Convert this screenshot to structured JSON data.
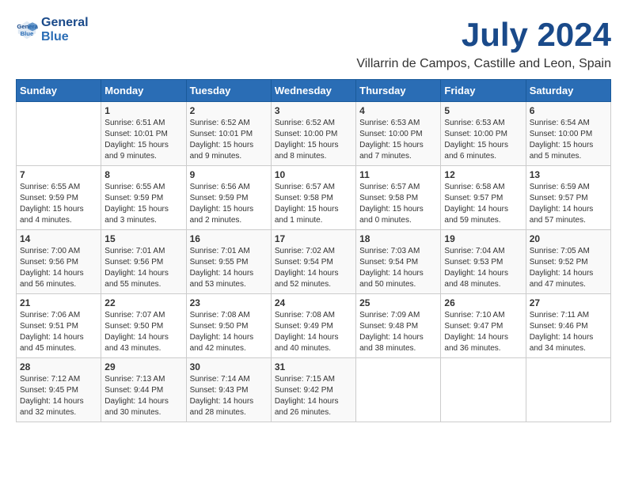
{
  "header": {
    "logo_line1": "General",
    "logo_line2": "Blue",
    "month_title": "July 2024",
    "location": "Villarrin de Campos, Castille and Leon, Spain"
  },
  "days_of_week": [
    "Sunday",
    "Monday",
    "Tuesday",
    "Wednesday",
    "Thursday",
    "Friday",
    "Saturday"
  ],
  "weeks": [
    [
      {
        "num": "",
        "info": ""
      },
      {
        "num": "1",
        "info": "Sunrise: 6:51 AM\nSunset: 10:01 PM\nDaylight: 15 hours\nand 9 minutes."
      },
      {
        "num": "2",
        "info": "Sunrise: 6:52 AM\nSunset: 10:01 PM\nDaylight: 15 hours\nand 9 minutes."
      },
      {
        "num": "3",
        "info": "Sunrise: 6:52 AM\nSunset: 10:00 PM\nDaylight: 15 hours\nand 8 minutes."
      },
      {
        "num": "4",
        "info": "Sunrise: 6:53 AM\nSunset: 10:00 PM\nDaylight: 15 hours\nand 7 minutes."
      },
      {
        "num": "5",
        "info": "Sunrise: 6:53 AM\nSunset: 10:00 PM\nDaylight: 15 hours\nand 6 minutes."
      },
      {
        "num": "6",
        "info": "Sunrise: 6:54 AM\nSunset: 10:00 PM\nDaylight: 15 hours\nand 5 minutes."
      }
    ],
    [
      {
        "num": "7",
        "info": "Sunrise: 6:55 AM\nSunset: 9:59 PM\nDaylight: 15 hours\nand 4 minutes."
      },
      {
        "num": "8",
        "info": "Sunrise: 6:55 AM\nSunset: 9:59 PM\nDaylight: 15 hours\nand 3 minutes."
      },
      {
        "num": "9",
        "info": "Sunrise: 6:56 AM\nSunset: 9:59 PM\nDaylight: 15 hours\nand 2 minutes."
      },
      {
        "num": "10",
        "info": "Sunrise: 6:57 AM\nSunset: 9:58 PM\nDaylight: 15 hours\nand 1 minute."
      },
      {
        "num": "11",
        "info": "Sunrise: 6:57 AM\nSunset: 9:58 PM\nDaylight: 15 hours\nand 0 minutes."
      },
      {
        "num": "12",
        "info": "Sunrise: 6:58 AM\nSunset: 9:57 PM\nDaylight: 14 hours\nand 59 minutes."
      },
      {
        "num": "13",
        "info": "Sunrise: 6:59 AM\nSunset: 9:57 PM\nDaylight: 14 hours\nand 57 minutes."
      }
    ],
    [
      {
        "num": "14",
        "info": "Sunrise: 7:00 AM\nSunset: 9:56 PM\nDaylight: 14 hours\nand 56 minutes."
      },
      {
        "num": "15",
        "info": "Sunrise: 7:01 AM\nSunset: 9:56 PM\nDaylight: 14 hours\nand 55 minutes."
      },
      {
        "num": "16",
        "info": "Sunrise: 7:01 AM\nSunset: 9:55 PM\nDaylight: 14 hours\nand 53 minutes."
      },
      {
        "num": "17",
        "info": "Sunrise: 7:02 AM\nSunset: 9:54 PM\nDaylight: 14 hours\nand 52 minutes."
      },
      {
        "num": "18",
        "info": "Sunrise: 7:03 AM\nSunset: 9:54 PM\nDaylight: 14 hours\nand 50 minutes."
      },
      {
        "num": "19",
        "info": "Sunrise: 7:04 AM\nSunset: 9:53 PM\nDaylight: 14 hours\nand 48 minutes."
      },
      {
        "num": "20",
        "info": "Sunrise: 7:05 AM\nSunset: 9:52 PM\nDaylight: 14 hours\nand 47 minutes."
      }
    ],
    [
      {
        "num": "21",
        "info": "Sunrise: 7:06 AM\nSunset: 9:51 PM\nDaylight: 14 hours\nand 45 minutes."
      },
      {
        "num": "22",
        "info": "Sunrise: 7:07 AM\nSunset: 9:50 PM\nDaylight: 14 hours\nand 43 minutes."
      },
      {
        "num": "23",
        "info": "Sunrise: 7:08 AM\nSunset: 9:50 PM\nDaylight: 14 hours\nand 42 minutes."
      },
      {
        "num": "24",
        "info": "Sunrise: 7:08 AM\nSunset: 9:49 PM\nDaylight: 14 hours\nand 40 minutes."
      },
      {
        "num": "25",
        "info": "Sunrise: 7:09 AM\nSunset: 9:48 PM\nDaylight: 14 hours\nand 38 minutes."
      },
      {
        "num": "26",
        "info": "Sunrise: 7:10 AM\nSunset: 9:47 PM\nDaylight: 14 hours\nand 36 minutes."
      },
      {
        "num": "27",
        "info": "Sunrise: 7:11 AM\nSunset: 9:46 PM\nDaylight: 14 hours\nand 34 minutes."
      }
    ],
    [
      {
        "num": "28",
        "info": "Sunrise: 7:12 AM\nSunset: 9:45 PM\nDaylight: 14 hours\nand 32 minutes."
      },
      {
        "num": "29",
        "info": "Sunrise: 7:13 AM\nSunset: 9:44 PM\nDaylight: 14 hours\nand 30 minutes."
      },
      {
        "num": "30",
        "info": "Sunrise: 7:14 AM\nSunset: 9:43 PM\nDaylight: 14 hours\nand 28 minutes."
      },
      {
        "num": "31",
        "info": "Sunrise: 7:15 AM\nSunset: 9:42 PM\nDaylight: 14 hours\nand 26 minutes."
      },
      {
        "num": "",
        "info": ""
      },
      {
        "num": "",
        "info": ""
      },
      {
        "num": "",
        "info": ""
      }
    ]
  ]
}
